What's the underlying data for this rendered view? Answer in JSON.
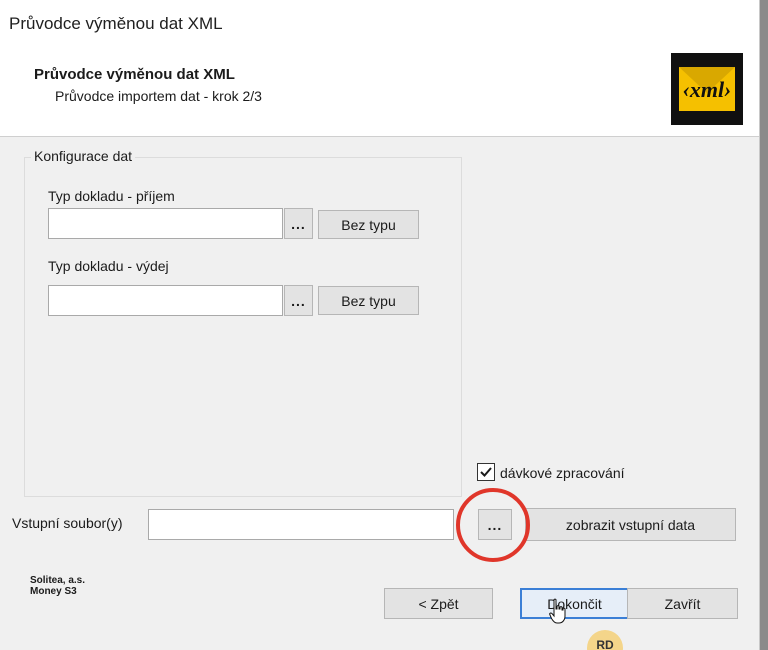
{
  "window": {
    "title": "Průvodce výměnou dat XML"
  },
  "header": {
    "title": "Průvodce výměnou dat XML",
    "subtitle": "Průvodce importem dat - krok 2/3",
    "logo_text": "‹xml›"
  },
  "config": {
    "group_label": "Konfigurace dat",
    "income": {
      "label": "Typ dokladu - příjem",
      "value": "",
      "browse": "...",
      "no_type": "Bez typu"
    },
    "expense": {
      "label": "Typ dokladu - výdej",
      "value": "",
      "browse": "...",
      "no_type": "Bez typu"
    }
  },
  "batch": {
    "label": "dávkové zpracování",
    "checked": true
  },
  "input_file": {
    "label": "Vstupní soubor(y)",
    "value": "",
    "browse": "...",
    "show_data": "zobrazit vstupní data"
  },
  "footer": {
    "company_line1": "Solitea, a.s.",
    "company_line2": "Money S3",
    "back": "< Zpět",
    "finish": "Dokončit",
    "close": "Zavřít"
  },
  "overlay": {
    "avatar_initials": "RD"
  },
  "colors": {
    "highlight": "#e0362a",
    "accent": "#3b7fd6",
    "logo_bg": "#101010",
    "logo_fg": "#f5c000"
  }
}
